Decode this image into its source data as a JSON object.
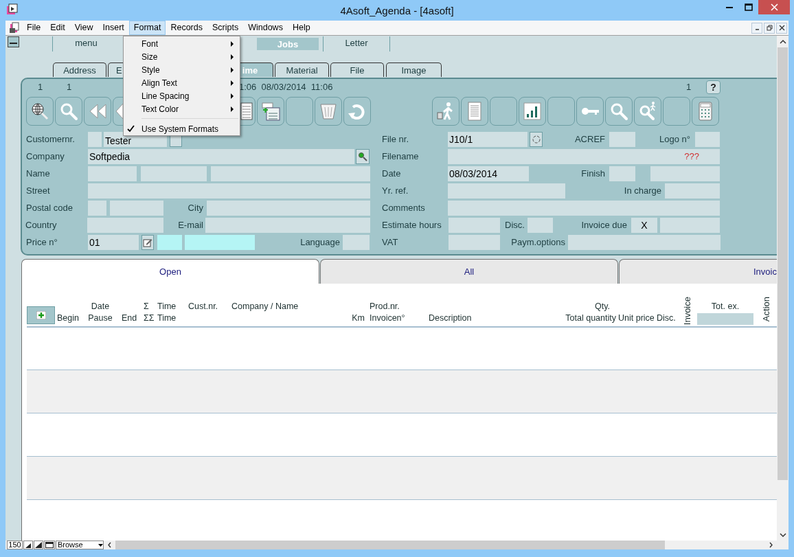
{
  "window": {
    "title": "4Asoft_Agenda - [4asoft]"
  },
  "menu_bar": [
    {
      "label": "File",
      "selected": false
    },
    {
      "label": "Edit",
      "selected": false
    },
    {
      "label": "View",
      "selected": false
    },
    {
      "label": "Insert",
      "selected": false
    },
    {
      "label": "Format",
      "selected": true
    },
    {
      "label": "Records",
      "selected": false
    },
    {
      "label": "Scripts",
      "selected": false
    },
    {
      "label": "Windows",
      "selected": false
    },
    {
      "label": "Help",
      "selected": false
    }
  ],
  "format_menu": [
    {
      "label": "Font",
      "submenu": true,
      "checked": false
    },
    {
      "label": "Size",
      "submenu": true,
      "checked": false
    },
    {
      "label": "Style",
      "submenu": true,
      "checked": false
    },
    {
      "label": "Align Text",
      "submenu": true,
      "checked": false
    },
    {
      "label": "Line Spacing",
      "submenu": true,
      "checked": false
    },
    {
      "label": "Text Color",
      "submenu": true,
      "checked": false
    },
    {
      "label": "Use System Formats",
      "submenu": false,
      "checked": true
    }
  ],
  "top_tabs": [
    {
      "label": "menu",
      "selected": false
    },
    {
      "label": "Jobs",
      "selected": true
    },
    {
      "label": "Letter",
      "selected": false
    }
  ],
  "sub_tabs": [
    {
      "label": "Address",
      "selected": false
    },
    {
      "label": "E",
      "selected": false
    },
    {
      "label": "ime",
      "selected": true
    },
    {
      "label": "Material",
      "selected": false
    },
    {
      "label": "File",
      "selected": false
    },
    {
      "label": "Image",
      "selected": false
    }
  ],
  "record_bar": {
    "counter_1": "1",
    "counter_2": "1",
    "timestamps": "1:06  08/03/2014  11:06",
    "page": "1",
    "help_button": "?"
  },
  "customer_form": [
    {
      "label": "Customernr.",
      "value": "Tester"
    },
    {
      "label": "Company",
      "value": "Softpedia"
    },
    {
      "label": "Name"
    },
    {
      "label": "Street"
    },
    {
      "label": "Postal code"
    },
    {
      "label": "City"
    },
    {
      "label": "Country"
    },
    {
      "label": "E-mail"
    },
    {
      "label": "Price n°",
      "value": "01"
    },
    {
      "label": "Language"
    }
  ],
  "job_form": [
    {
      "label": "File nr.",
      "value": "J10/1"
    },
    {
      "label": "ACREF"
    },
    {
      "label": "Logo n°"
    },
    {
      "label": "Filename",
      "value": "???"
    },
    {
      "label": "Date",
      "value": "08/03/2014"
    },
    {
      "label": "Finish"
    },
    {
      "label": "Yr. ref."
    },
    {
      "label": "In charge"
    },
    {
      "label": "Comments"
    },
    {
      "label": "Estimate hours"
    },
    {
      "label": "Disc."
    },
    {
      "label": "Invoice due",
      "value": "X"
    },
    {
      "label": "VAT"
    },
    {
      "label": "Paym.options"
    }
  ],
  "list_tabs": [
    {
      "label": "Open",
      "selected": true
    },
    {
      "label": "All",
      "selected": false
    },
    {
      "label": "Invoic",
      "selected": false
    }
  ],
  "list_columns": [
    {
      "line_2": "Begin"
    },
    {
      "line_1": "Date",
      "line_2": "Pause"
    },
    {
      "line_2": "End"
    },
    {
      "line_1": "Σ",
      "line_2": "ΣΣ"
    },
    {
      "line_1": "Time",
      "line_2": "Time"
    },
    {
      "line_1": "Cust.nr."
    },
    {
      "line_1": "Company / Name"
    },
    {
      "line_2": "Km"
    },
    {
      "line_1": "Prod.nr.",
      "line_2": "Invoicen°"
    },
    {
      "line_2": "Description"
    },
    {
      "line_1": "Qty.",
      "line_2": "Total quantity"
    },
    {
      "line_2": "Unit price"
    },
    {
      "line_2": "Disc."
    },
    {
      "vertical": "Invoice"
    },
    {
      "line_1": "Tot. ex."
    },
    {
      "vertical": "Action"
    }
  ],
  "status_bar": {
    "zoom": "150",
    "mode": "Browse"
  }
}
